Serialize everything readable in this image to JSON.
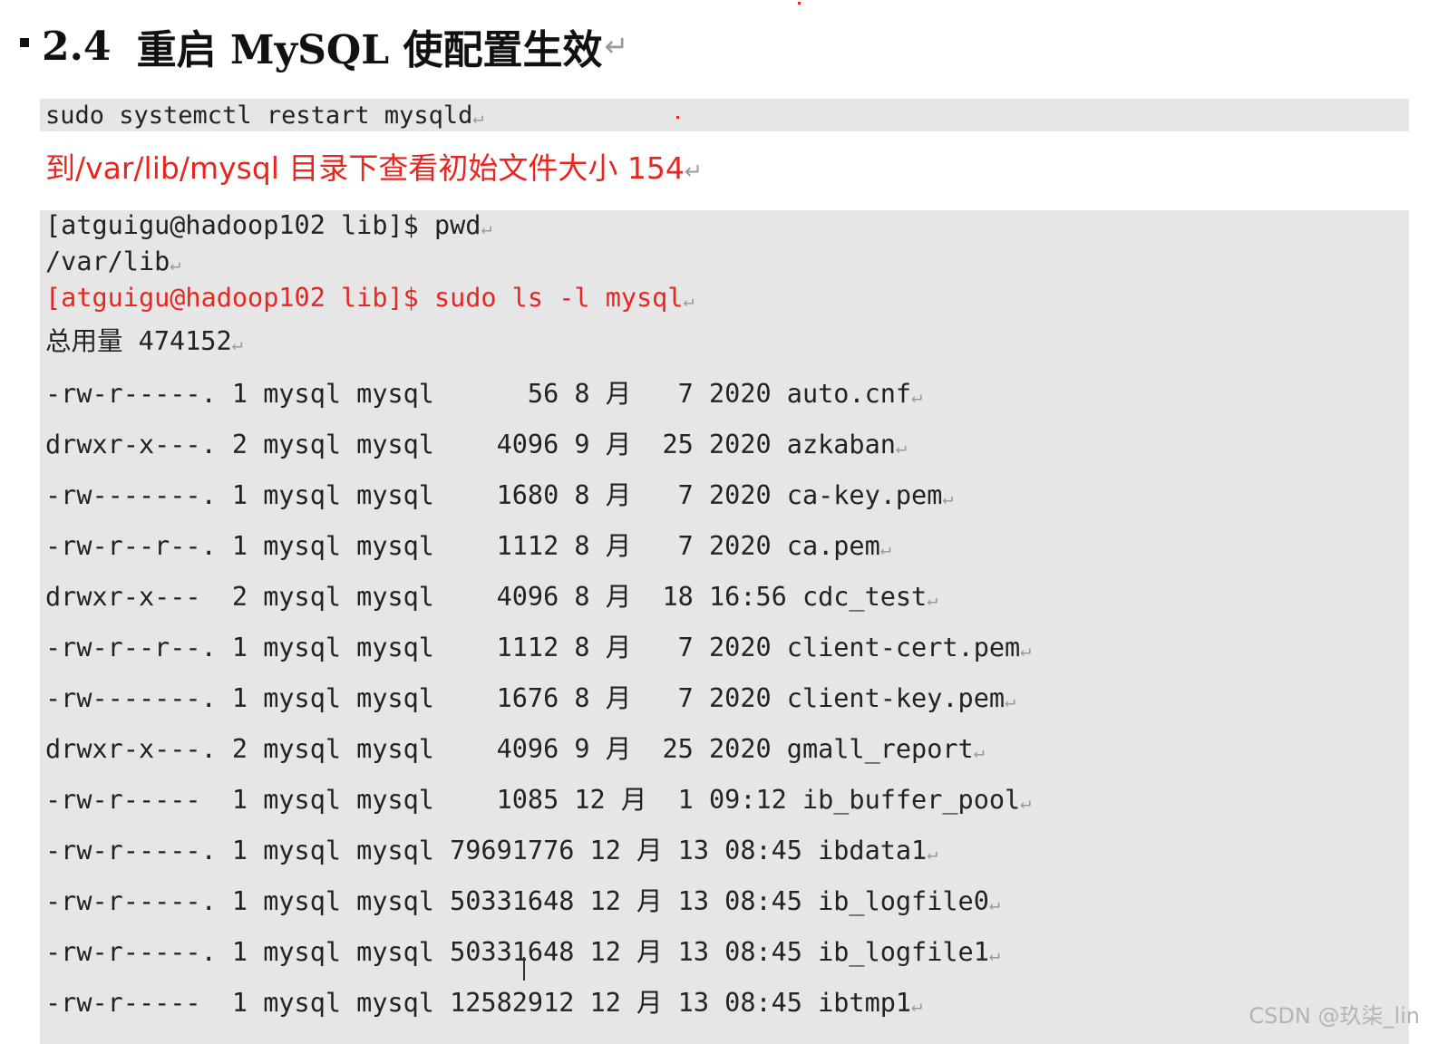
{
  "heading": {
    "number": "2.4",
    "title": "重启 MySQL 使配置生效",
    "paragraph_mark": "↵"
  },
  "command_block": {
    "text": "sudo systemctl restart mysqld"
  },
  "note": {
    "text": "到/var/lib/mysql 目录下查看初始文件大小 154"
  },
  "terminal": {
    "lines": [
      {
        "text": "[atguigu@hadoop102 lib]$ pwd",
        "color": "default"
      },
      {
        "text": "/var/lib",
        "color": "default"
      },
      {
        "text": "[atguigu@hadoop102 lib]$ sudo ls -l mysql",
        "color": "#e8261f"
      },
      {
        "text": "总用量 474152",
        "color": "default"
      },
      {
        "text": "-rw-r-----. 1 mysql mysql      56 8 月   7 2020 auto.cnf",
        "color": "default"
      },
      {
        "text": "drwxr-x---. 2 mysql mysql    4096 9 月  25 2020 azkaban",
        "color": "default"
      },
      {
        "text": "-rw-------. 1 mysql mysql    1680 8 月   7 2020 ca-key.pem",
        "color": "default"
      },
      {
        "text": "-rw-r--r--. 1 mysql mysql    1112 8 月   7 2020 ca.pem",
        "color": "default"
      },
      {
        "text": "drwxr-x---  2 mysql mysql    4096 8 月  18 16:56 cdc_test",
        "color": "default"
      },
      {
        "text": "-rw-r--r--. 1 mysql mysql    1112 8 月   7 2020 client-cert.pem",
        "color": "default"
      },
      {
        "text": "-rw-------. 1 mysql mysql    1676 8 月   7 2020 client-key.pem",
        "color": "default"
      },
      {
        "text": "drwxr-x---. 2 mysql mysql    4096 9 月  25 2020 gmall_report",
        "color": "default"
      },
      {
        "text": "-rw-r-----  1 mysql mysql    1085 12 月  1 09:12 ib_buffer_pool",
        "color": "default"
      },
      {
        "text": "-rw-r-----. 1 mysql mysql 79691776 12 月 13 08:45 ibdata1",
        "color": "default"
      },
      {
        "text": "-rw-r-----. 1 mysql mysql 50331648 12 月 13 08:45 ib_logfile0",
        "color": "default"
      },
      {
        "text": "-rw-r-----. 1 mysql mysql 50331648 12 月 13 08:45 ib_logfile1",
        "color": "default"
      },
      {
        "text": "-rw-r-----  1 mysql mysql 12582912 12 月 13 08:45 ibtmp1",
        "color": "default"
      }
    ]
  },
  "watermark": "CSDN @玖柒_lin",
  "colors": {
    "accent_red": "#e8261f",
    "code_background": "#e6e6e6",
    "text": "#222222"
  }
}
